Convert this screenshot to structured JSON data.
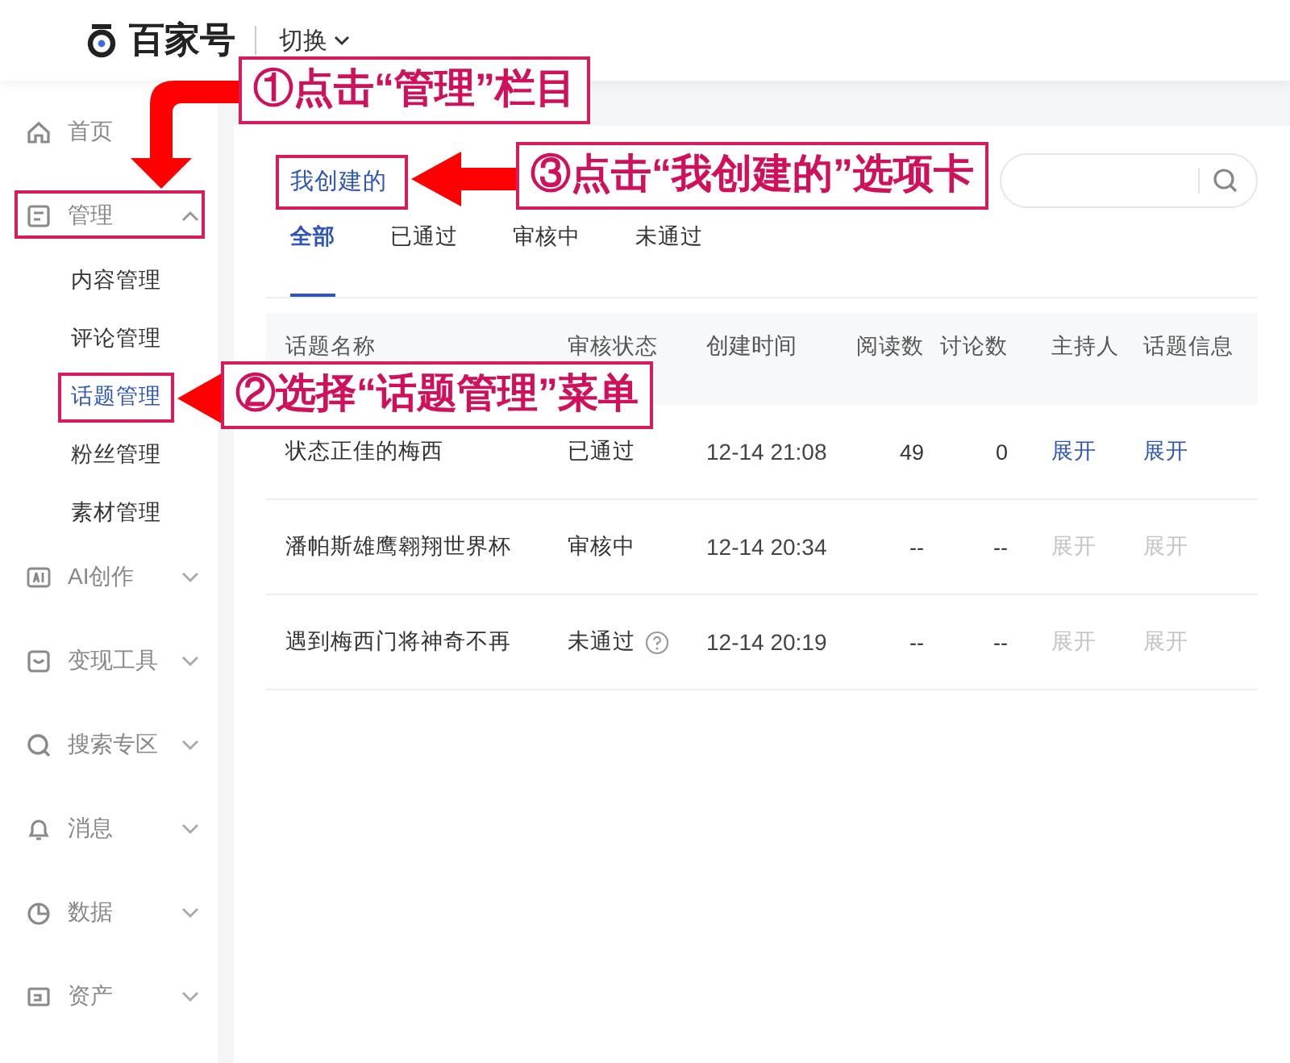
{
  "header": {
    "logo_text": "百家号",
    "switch_label": "切换"
  },
  "sidebar": {
    "items": [
      {
        "label": "首页",
        "kind": "home"
      },
      {
        "label": "管理",
        "kind": "manage",
        "expanded": true,
        "children": [
          {
            "label": "内容管理",
            "selected": false
          },
          {
            "label": "评论管理",
            "selected": false
          },
          {
            "label": "话题管理",
            "selected": true
          },
          {
            "label": "粉丝管理",
            "selected": false
          },
          {
            "label": "素材管理",
            "selected": false
          }
        ]
      },
      {
        "label": "AI创作",
        "kind": "ai",
        "expanded": false
      },
      {
        "label": "变现工具",
        "kind": "monetize",
        "expanded": false
      },
      {
        "label": "搜索专区",
        "kind": "search",
        "expanded": false
      },
      {
        "label": "消息",
        "kind": "message",
        "expanded": false
      },
      {
        "label": "数据",
        "kind": "data",
        "expanded": false
      },
      {
        "label": "资产",
        "kind": "asset",
        "expanded": false
      }
    ]
  },
  "main": {
    "tabs": [
      {
        "label": "我创建的",
        "selected": true
      }
    ],
    "filters": [
      {
        "label": "全部",
        "selected": true
      },
      {
        "label": "已通过",
        "selected": false
      },
      {
        "label": "审核中",
        "selected": false
      },
      {
        "label": "未通过",
        "selected": false
      }
    ],
    "table": {
      "columns": [
        "话题名称",
        "审核状态",
        "创建时间",
        "阅读数",
        "讨论数",
        "主持人",
        "话题信息"
      ],
      "rows": [
        {
          "cells": [
            "状态正佳的梅西",
            "已通过",
            "12-14 21:08",
            "49",
            "0"
          ],
          "help": false,
          "links": [
            {
              "label": "展开",
              "disabled": false
            },
            {
              "label": "展开",
              "disabled": false
            }
          ]
        },
        {
          "cells": [
            "潘帕斯雄鹰翱翔世界杯",
            "审核中",
            "12-14 20:34",
            "--",
            "--"
          ],
          "help": false,
          "links": [
            {
              "label": "展开",
              "disabled": true
            },
            {
              "label": "展开",
              "disabled": true
            }
          ]
        },
        {
          "cells": [
            "遇到梅西门将神奇不再",
            "未通过",
            "12-14 20:19",
            "--",
            "--"
          ],
          "help": true,
          "links": [
            {
              "label": "展开",
              "disabled": true
            },
            {
              "label": "展开",
              "disabled": true
            }
          ]
        }
      ]
    }
  },
  "annotations": {
    "callouts": [
      {
        "text": "①点击“管理”栏目"
      },
      {
        "text": "③点击“我创建的”选项卡"
      },
      {
        "text": "②选择“话题管理”菜单"
      }
    ]
  }
}
